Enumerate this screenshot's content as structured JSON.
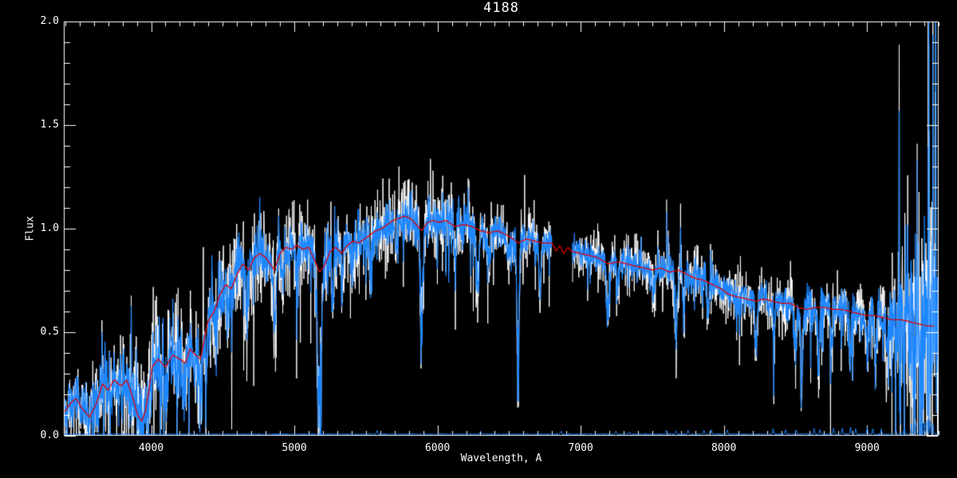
{
  "window": {
    "background_color": "#000000",
    "foreground_color": "#ffffff"
  },
  "chart_data": {
    "type": "line",
    "title": "4188",
    "xlabel": "Wavelength, A",
    "ylabel": "Flux",
    "xlim": [
      3390,
      9500
    ],
    "ylim": [
      0.0,
      2.0
    ],
    "x_ticks": [
      4000,
      5000,
      6000,
      7000,
      8000,
      9000
    ],
    "x_tick_labels": [
      "4000",
      "5000",
      "6000",
      "7000",
      "8000",
      "9000"
    ],
    "x_minor_step": 100,
    "y_ticks": [
      0.0,
      0.5,
      1.0,
      1.5,
      2.0
    ],
    "y_tick_labels": [
      "0.0",
      "0.5",
      "1.0",
      "1.5",
      "2.0"
    ],
    "y_minor_step": 0.1,
    "grid": false,
    "legend": "none",
    "frame_color": "#ffffff",
    "noise_seed": 42,
    "mask_gap": [
      6798,
      6942
    ],
    "series": [
      {
        "name": "raw-spectrum",
        "color": "#ffffff",
        "style": "noisy",
        "noise_scale": 1.55
      },
      {
        "name": "observed-spectrum",
        "color": "#1e87ff",
        "style": "noisy",
        "noise_scale": 0.95
      },
      {
        "name": "model-fit",
        "color": "#e40000",
        "style": "smooth",
        "x": [
          3390,
          3440,
          3475,
          3520,
          3570,
          3620,
          3660,
          3700,
          3740,
          3790,
          3830,
          3870,
          3905,
          3935,
          3960,
          3985,
          4005,
          4050,
          4101,
          4150,
          4200,
          4240,
          4270,
          4310,
          4345,
          4395,
          4440,
          4480,
          4520,
          4560,
          4600,
          4640,
          4680,
          4720,
          4760,
          4800,
          4830,
          4861,
          4900,
          4940,
          4980,
          5020,
          5060,
          5100,
          5140,
          5175,
          5210,
          5250,
          5290,
          5330,
          5370,
          5410,
          5450,
          5490,
          5530,
          5570,
          5610,
          5650,
          5690,
          5730,
          5770,
          5810,
          5850,
          5890,
          5930,
          5970,
          6010,
          6060,
          6120,
          6180,
          6240,
          6300,
          6360,
          6420,
          6480,
          6530,
          6563,
          6620,
          6680,
          6740,
          6800,
          6830,
          6855,
          6880,
          6910,
          6940,
          7000,
          7060,
          7120,
          7190,
          7260,
          7320,
          7380,
          7440,
          7500,
          7560,
          7620,
          7680,
          7740,
          7800,
          7860,
          7920,
          7980,
          8040,
          8100,
          8160,
          8220,
          8280,
          8340,
          8400,
          8460,
          8520,
          8580,
          8640,
          8700,
          8760,
          8820,
          8880,
          8940,
          9000,
          9060,
          9120,
          9180,
          9240,
          9300,
          9360,
          9420,
          9470
        ],
        "y": [
          0.11,
          0.16,
          0.18,
          0.13,
          0.09,
          0.16,
          0.25,
          0.22,
          0.27,
          0.24,
          0.27,
          0.19,
          0.1,
          0.07,
          0.12,
          0.22,
          0.33,
          0.37,
          0.33,
          0.39,
          0.37,
          0.35,
          0.42,
          0.39,
          0.37,
          0.55,
          0.6,
          0.68,
          0.73,
          0.71,
          0.78,
          0.83,
          0.8,
          0.86,
          0.88,
          0.86,
          0.83,
          0.8,
          0.88,
          0.91,
          0.9,
          0.92,
          0.9,
          0.91,
          0.85,
          0.79,
          0.82,
          0.89,
          0.91,
          0.88,
          0.92,
          0.94,
          0.93,
          0.95,
          0.97,
          0.99,
          1.0,
          1.02,
          1.04,
          1.05,
          1.06,
          1.05,
          1.02,
          0.99,
          1.03,
          1.04,
          1.03,
          1.04,
          1.01,
          1.02,
          1.01,
          0.99,
          0.98,
          0.99,
          0.97,
          0.95,
          0.93,
          0.95,
          0.94,
          0.93,
          0.93,
          0.89,
          0.92,
          0.88,
          0.91,
          0.89,
          0.88,
          0.87,
          0.86,
          0.83,
          0.84,
          0.83,
          0.82,
          0.81,
          0.8,
          0.81,
          0.79,
          0.8,
          0.78,
          0.76,
          0.75,
          0.73,
          0.71,
          0.68,
          0.67,
          0.66,
          0.65,
          0.66,
          0.65,
          0.64,
          0.64,
          0.62,
          0.61,
          0.62,
          0.62,
          0.61,
          0.61,
          0.6,
          0.59,
          0.58,
          0.58,
          0.57,
          0.56,
          0.56,
          0.55,
          0.54,
          0.53,
          0.53
        ]
      },
      {
        "name": "sky-spectrum",
        "color": "#1e87ff",
        "style": "sky",
        "base_flux": 0.008,
        "line_sigma": 3.5,
        "emission_lines": [
          [
            5577,
            0.018
          ],
          [
            6300,
            0.014
          ],
          [
            6864,
            0.016
          ],
          [
            7246,
            0.014
          ],
          [
            7340,
            0.012
          ],
          [
            7600,
            0.018
          ],
          [
            7665,
            0.015
          ],
          [
            7750,
            0.016
          ],
          [
            7860,
            0.02
          ],
          [
            7913,
            0.02
          ],
          [
            8025,
            0.02
          ],
          [
            8344,
            0.026
          ],
          [
            8430,
            0.022
          ],
          [
            8505,
            0.02
          ],
          [
            8630,
            0.026
          ],
          [
            8670,
            0.022
          ],
          [
            8767,
            0.03
          ],
          [
            8827,
            0.028
          ],
          [
            8885,
            0.032
          ],
          [
            8920,
            0.026
          ],
          [
            9001,
            0.032
          ],
          [
            9040,
            0.026
          ],
          [
            9100,
            0.022
          ],
          [
            9200,
            0.03
          ],
          [
            9260,
            0.035
          ],
          [
            9310,
            0.05
          ],
          [
            9340,
            0.06
          ],
          [
            9375,
            0.05
          ],
          [
            9400,
            0.055
          ],
          [
            9420,
            0.07
          ],
          [
            9440,
            0.06
          ],
          [
            9460,
            0.05
          ]
        ]
      }
    ],
    "absorption_lines": [
      [
        3933,
        8,
        0.08
      ],
      [
        3968,
        8,
        0.08
      ],
      [
        4101,
        9,
        0.18
      ],
      [
        4227,
        7,
        0.15
      ],
      [
        4300,
        9,
        0.15
      ],
      [
        4340,
        9,
        0.2
      ],
      [
        4383,
        7,
        0.2
      ],
      [
        4455,
        7,
        0.18
      ],
      [
        4531,
        7,
        0.16
      ],
      [
        4668,
        8,
        0.22
      ],
      [
        4861,
        9,
        0.28
      ],
      [
        4920,
        7,
        0.18
      ],
      [
        5015,
        7,
        0.16
      ],
      [
        5175,
        12,
        0.8
      ],
      [
        5270,
        8,
        0.22
      ],
      [
        5335,
        7,
        0.18
      ],
      [
        5406,
        7,
        0.16
      ],
      [
        5530,
        7,
        0.15
      ],
      [
        5711,
        7,
        0.16
      ],
      [
        5890,
        9,
        0.55
      ],
      [
        6122,
        7,
        0.18
      ],
      [
        6280,
        9,
        0.28
      ],
      [
        6360,
        7,
        0.16
      ],
      [
        6495,
        7,
        0.18
      ],
      [
        6563,
        7,
        0.72
      ],
      [
        6717,
        7,
        0.22
      ],
      [
        7190,
        10,
        0.26
      ],
      [
        7260,
        7,
        0.16
      ],
      [
        7510,
        7,
        0.14
      ],
      [
        7665,
        9,
        0.28
      ],
      [
        7720,
        7,
        0.18
      ],
      [
        7890,
        7,
        0.16
      ],
      [
        8227,
        7,
        0.22
      ],
      [
        8350,
        7,
        0.18
      ],
      [
        8498,
        7,
        0.28
      ],
      [
        8542,
        8,
        0.32
      ],
      [
        8662,
        8,
        0.3
      ],
      [
        8750,
        7,
        0.2
      ],
      [
        8880,
        7,
        0.24
      ],
      [
        9000,
        7,
        0.24
      ],
      [
        9060,
        7,
        0.22
      ],
      [
        9140,
        7,
        0.26
      ]
    ],
    "emission_spikes": [
      [
        7600,
        0.8,
        1.08,
        1.14
      ],
      [
        7612,
        0.8,
        0.96,
        0.99
      ],
      [
        9350,
        0.35,
        1.33,
        1.41
      ],
      [
        9434,
        0.08,
        1.47,
        1.47
      ],
      [
        9456,
        0.3,
        0.96,
        0.96
      ],
      [
        9474,
        0.4,
        0.9,
        0.93
      ]
    ],
    "noise_profile": [
      [
        3390,
        0.055
      ],
      [
        3600,
        0.07
      ],
      [
        3800,
        0.095
      ],
      [
        4000,
        0.1
      ],
      [
        4200,
        0.1
      ],
      [
        4400,
        0.09
      ],
      [
        4700,
        0.08
      ],
      [
        5000,
        0.07
      ],
      [
        5400,
        0.062
      ],
      [
        5800,
        0.058
      ],
      [
        6200,
        0.05
      ],
      [
        6600,
        0.042
      ],
      [
        7000,
        0.034
      ],
      [
        7400,
        0.038
      ],
      [
        7800,
        0.042
      ],
      [
        8200,
        0.045
      ],
      [
        8600,
        0.05
      ],
      [
        9000,
        0.055
      ],
      [
        9150,
        0.08
      ],
      [
        9280,
        0.15
      ],
      [
        9400,
        0.28
      ],
      [
        9500,
        0.3
      ]
    ]
  }
}
